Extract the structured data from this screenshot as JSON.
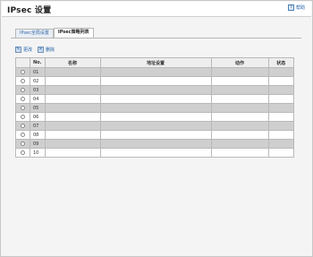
{
  "header": {
    "title": "IPsec 设置",
    "help_label": "帮助"
  },
  "tabs": [
    {
      "label": "IPsec全局设置",
      "active": false
    },
    {
      "label": "IPsec策略列表",
      "active": true
    }
  ],
  "actions": {
    "change_label": "更改",
    "delete_label": "删除"
  },
  "table": {
    "columns": [
      "",
      "No.",
      "名称",
      "地址设置",
      "动作",
      "状态"
    ],
    "rows": [
      {
        "no": "01",
        "name": "",
        "address": "",
        "action": "",
        "status": ""
      },
      {
        "no": "02",
        "name": "",
        "address": "",
        "action": "",
        "status": ""
      },
      {
        "no": "03",
        "name": "",
        "address": "",
        "action": "",
        "status": ""
      },
      {
        "no": "04",
        "name": "",
        "address": "",
        "action": "",
        "status": ""
      },
      {
        "no": "05",
        "name": "",
        "address": "",
        "action": "",
        "status": ""
      },
      {
        "no": "06",
        "name": "",
        "address": "",
        "action": "",
        "status": ""
      },
      {
        "no": "07",
        "name": "",
        "address": "",
        "action": "",
        "status": ""
      },
      {
        "no": "08",
        "name": "",
        "address": "",
        "action": "",
        "status": ""
      },
      {
        "no": "09",
        "name": "",
        "address": "",
        "action": "",
        "status": ""
      },
      {
        "no": "10",
        "name": "",
        "address": "",
        "action": "",
        "status": ""
      }
    ]
  },
  "colors": {
    "row_dark": "#cfcfcf",
    "row_light": "#ffffff",
    "link": "#1f5fa8"
  },
  "icons": {
    "help": "help-icon",
    "change": "edit-icon",
    "delete": "delete-icon",
    "row_select": "radio-button"
  }
}
